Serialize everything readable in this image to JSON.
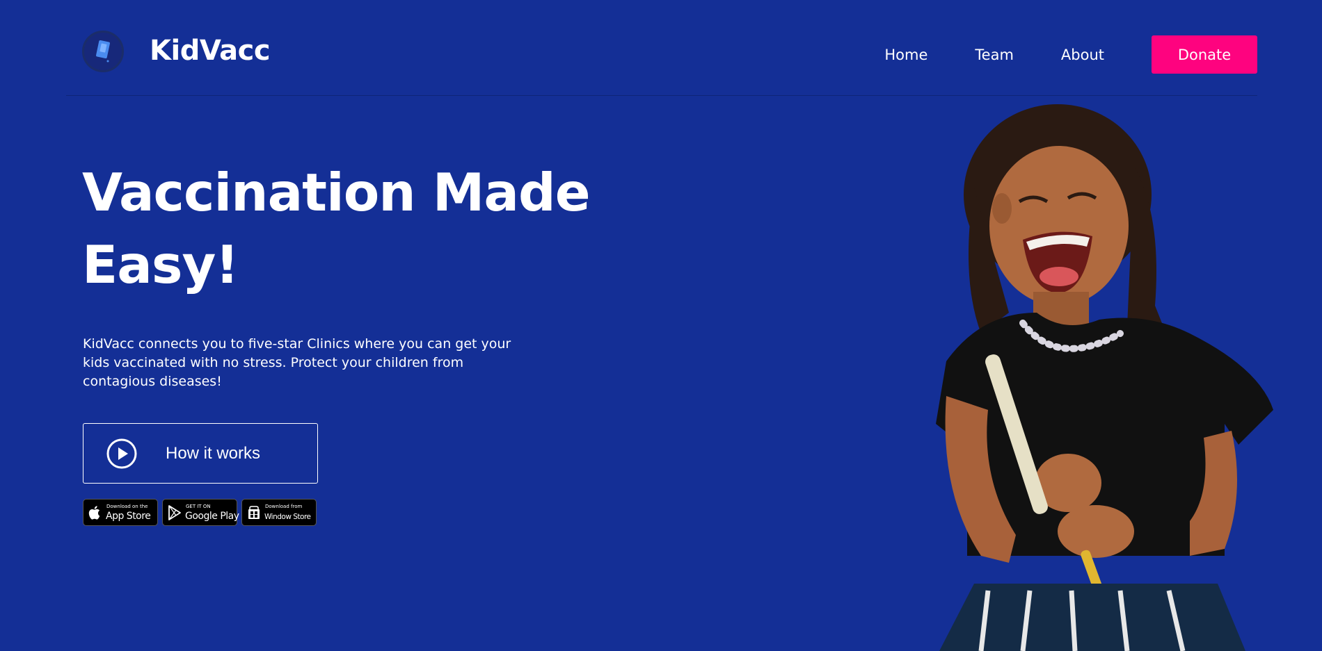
{
  "header": {
    "brand": "KidVacc",
    "nav": [
      {
        "label": "Home"
      },
      {
        "label": "Team"
      },
      {
        "label": "About"
      }
    ],
    "donate_label": "Donate"
  },
  "hero": {
    "title_line1": "Vaccination Made",
    "title_line2": "Easy!",
    "description": "KidVacc connects you to five-star Clinics where you can get your kids vaccinated with no stress. Protect your children from contagious diseases!",
    "how_it_works_label": "How it works"
  },
  "badges": [
    {
      "small": "Download on the",
      "big": "App Store",
      "icon": "apple-icon"
    },
    {
      "small": "GET IT ON",
      "big": "Google Play",
      "icon": "google-play-icon"
    },
    {
      "small": "Download from",
      "big": "Window Store",
      "icon": "windows-icon"
    }
  ],
  "colors": {
    "background": "#142f96",
    "accent": "#fe037f",
    "text": "#ffffff"
  }
}
